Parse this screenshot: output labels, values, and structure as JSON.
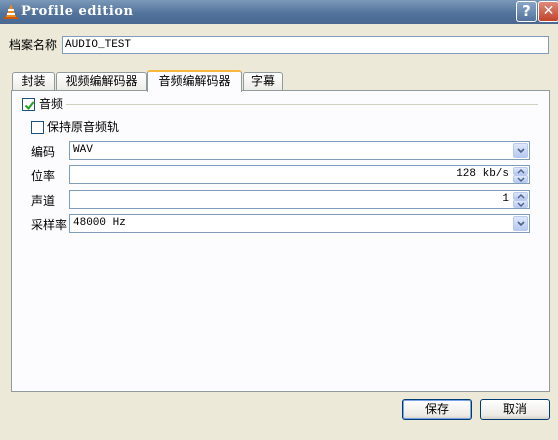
{
  "window": {
    "title": "Profile edition",
    "help_glyph": "?",
    "close_glyph": "✕"
  },
  "profile_name": {
    "label": "档案名称",
    "value": "AUDIO_TEST"
  },
  "tabs": [
    {
      "label": "封装",
      "active": false
    },
    {
      "label": "视频编解码器",
      "active": false
    },
    {
      "label": "音频编解码器",
      "active": true
    },
    {
      "label": "字幕",
      "active": false
    }
  ],
  "audio": {
    "group_label": "音频",
    "group_checked": true,
    "keep_original_label": "保持原音频轨",
    "keep_original_checked": false,
    "codec": {
      "label": "编码",
      "value": "WAV"
    },
    "bitrate": {
      "label": "位率",
      "value": "128 kb/s"
    },
    "channels": {
      "label": "声道",
      "value": "1"
    },
    "samplerate": {
      "label": "采样率",
      "value": "48000 Hz"
    }
  },
  "buttons": {
    "save": "保存",
    "cancel": "取消"
  },
  "colors": {
    "titlebar": "#52739c",
    "accent_tab": "#f7b83c",
    "check": "#21a121"
  }
}
